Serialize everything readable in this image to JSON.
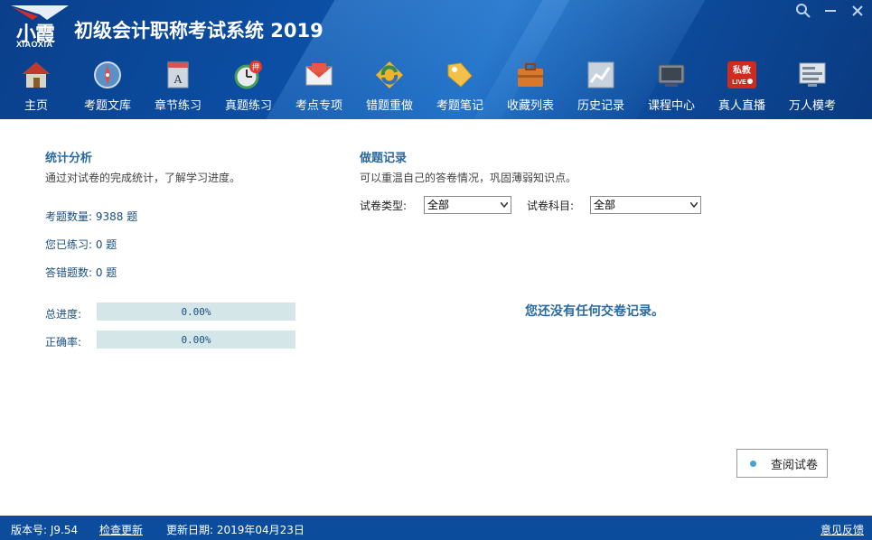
{
  "header": {
    "logo_cn": "小霞",
    "logo_en": "XIAOXIA",
    "title": "初级会计职称考试系统 2019"
  },
  "toolbar": [
    {
      "label": "主页",
      "icon": "home-icon"
    },
    {
      "label": "考题文库",
      "icon": "compass-icon"
    },
    {
      "label": "章节练习",
      "icon": "book-icon"
    },
    {
      "label": "真题练习",
      "icon": "clock-icon",
      "badge": "押"
    },
    {
      "label": "考点专项",
      "icon": "mail-icon"
    },
    {
      "label": "错题重做",
      "icon": "refresh-icon"
    },
    {
      "label": "考题笔记",
      "icon": "tag-icon"
    },
    {
      "label": "收藏列表",
      "icon": "briefcase-icon"
    },
    {
      "label": "历史记录",
      "icon": "chart-icon"
    },
    {
      "label": "课程中心",
      "icon": "tv-icon"
    },
    {
      "label": "真人直播",
      "icon": "live-icon",
      "badge_top": "私教",
      "badge_bottom": "LIVE"
    },
    {
      "label": "万人模考",
      "icon": "monitor-icon"
    }
  ],
  "stats": {
    "title": "统计分析",
    "desc": "通过对试卷的完成统计，了解学习进度。",
    "question_count": "考题数量: 9388 题",
    "practiced": "您已练习: 0 题",
    "wrong": "答错题数: 0 题",
    "progress_label": "总进度:",
    "progress_value": "0.00%",
    "progress_fraction": 0.0,
    "accuracy_label": "正确率:",
    "accuracy_value": "0.00%",
    "accuracy_fraction": 0.0
  },
  "records": {
    "title": "做题记录",
    "desc": "可以重温自己的答卷情况，巩固薄弱知识点。",
    "type_label": "试卷类型:",
    "type_value": "全部",
    "subject_label": "试卷科目:",
    "subject_value": "全部",
    "empty_msg": "您还没有任何交卷记录。",
    "review_button": "查阅试卷"
  },
  "footer": {
    "version": "版本号: J9.54",
    "check_update": "检查更新",
    "update_date": "更新日期: 2019年04月23日",
    "feedback": "意见反馈"
  }
}
